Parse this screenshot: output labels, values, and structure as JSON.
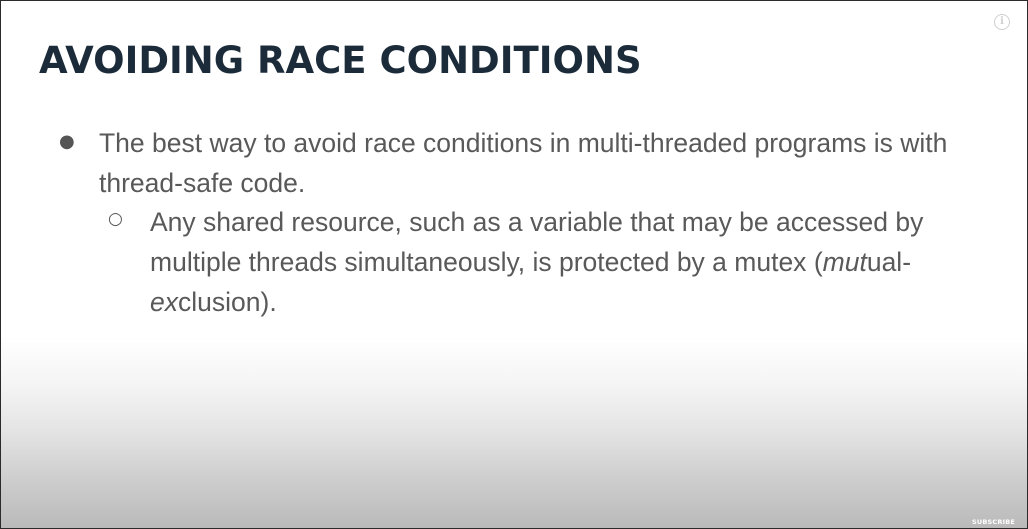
{
  "slide": {
    "title": "AVOIDING RACE CONDITIONS",
    "bullet_symbol_l1": "●",
    "bullet_symbol_l2": "○",
    "bullet1_text": "The best way to avoid race conditions in multi-threaded programs is with thread-safe code.",
    "sub_bullet": {
      "text_main": "Any shared resource, such as a variable that may be accessed by multiple threads simultaneously, is protected by a mutex",
      "paren_open": "(",
      "mut_italic": "mut",
      "ual_plain": "ual-",
      "ex_italic": "ex",
      "clusion_plain": "clusion)."
    }
  },
  "player": {
    "info_icon_glyph": "i",
    "subscribe_label": "SUBSCRIBE"
  },
  "colors": {
    "title": "#1c2b3a",
    "body_text": "#595959"
  }
}
